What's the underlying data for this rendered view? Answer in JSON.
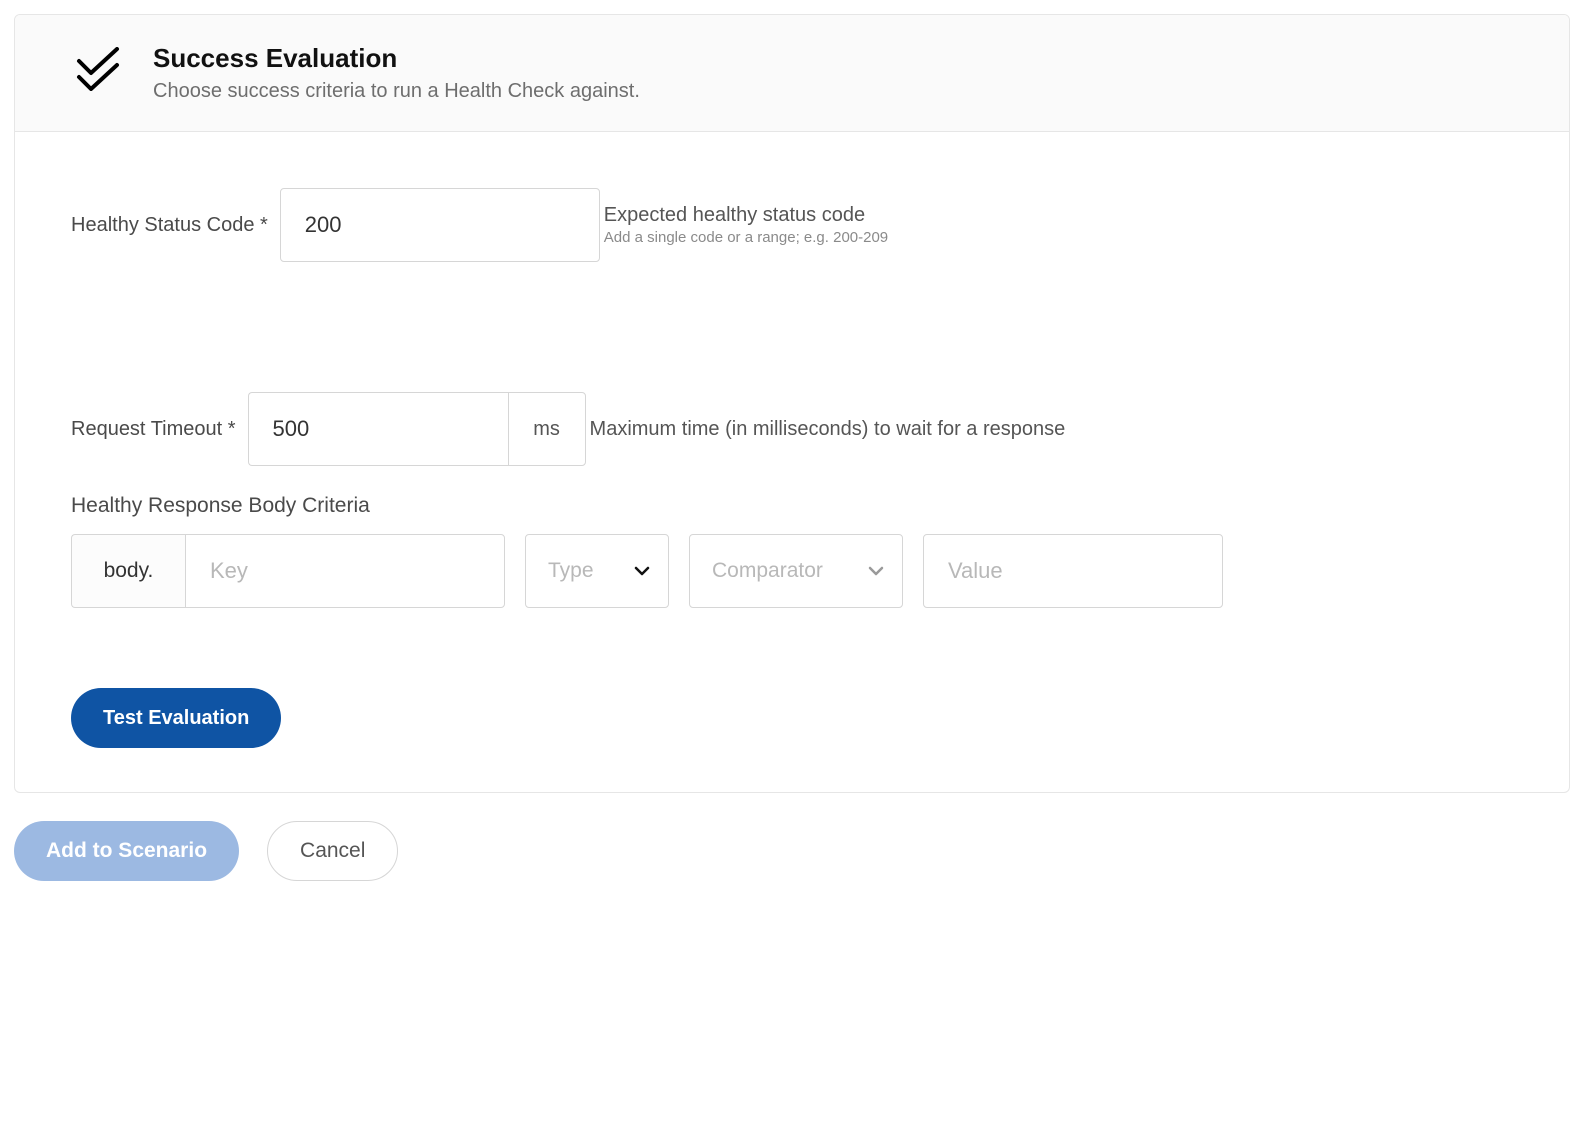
{
  "panel": {
    "title": "Success Evaluation",
    "subtitle": "Choose success criteria to run a Health Check against."
  },
  "statusCode": {
    "label": "Healthy Status Code *",
    "value": "200",
    "hint_main": "Expected healthy status code",
    "hint_sub": "Add a single code or a range; e.g. 200-209"
  },
  "timeout": {
    "label": "Request Timeout *",
    "value": "500",
    "unit": "ms",
    "hint_main": "Maximum time (in milliseconds) to wait for a response"
  },
  "criteria": {
    "section_label": "Healthy Response Body Criteria",
    "prefix": "body.",
    "key_placeholder": "Key",
    "type_placeholder": "Type",
    "comparator_placeholder": "Comparator",
    "value_placeholder": "Value"
  },
  "buttons": {
    "test": "Test Evaluation",
    "add": "Add to Scenario",
    "cancel": "Cancel"
  }
}
